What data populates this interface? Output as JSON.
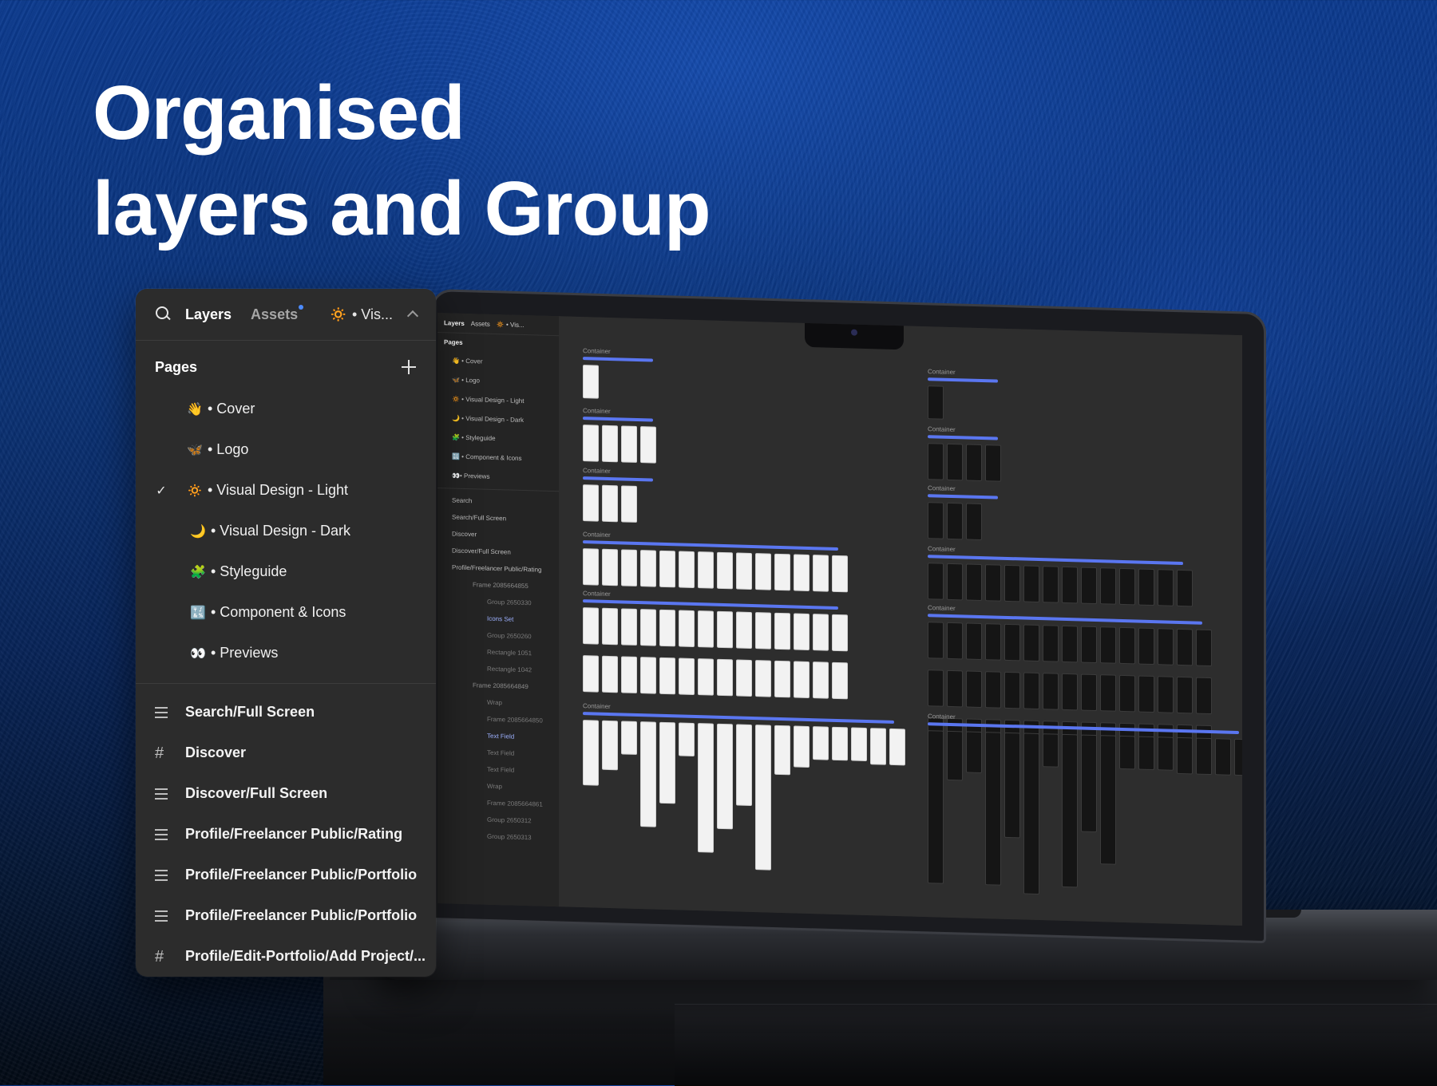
{
  "headline": {
    "line1": "Organised",
    "line2": "layers and Group"
  },
  "panel": {
    "tab_layers": "Layers",
    "tab_assets": "Assets",
    "current_page_emoji": "🔅",
    "current_page_label": "• Vis...",
    "pages_header": "Pages",
    "pages": [
      {
        "emoji": "👋",
        "label": "• Cover",
        "selected": false
      },
      {
        "emoji": "🦋",
        "label": "• Logo",
        "selected": false
      },
      {
        "emoji": "🔅",
        "label": "• Visual Design - Light",
        "selected": true
      },
      {
        "emoji": "🌙",
        "label": "• Visual Design - Dark",
        "selected": false
      },
      {
        "emoji": "🧩",
        "label": "• Styleguide",
        "selected": false
      },
      {
        "emoji": "🔣",
        "label": "• Component & Icons",
        "selected": false
      },
      {
        "emoji": "👀",
        "label": "• Previews",
        "selected": false
      }
    ],
    "layers": [
      {
        "icon": "lines",
        "label": "Search/Full Screen"
      },
      {
        "icon": "hash",
        "label": "Discover"
      },
      {
        "icon": "lines",
        "label": "Discover/Full Screen"
      },
      {
        "icon": "lines",
        "label": "Profile/Freelancer Public/Rating"
      },
      {
        "icon": "lines",
        "label": "Profile/Freelancer Public/Portfolio"
      },
      {
        "icon": "lines",
        "label": "Profile/Freelancer Public/Portfolio"
      },
      {
        "icon": "hash",
        "label": "Profile/Edit-Portfolio/Add Project/..."
      }
    ],
    "check_glyph": "✓"
  },
  "mini_sidebar": {
    "tab_layers": "Layers",
    "tab_assets": "Assets",
    "current": "🔅 • Vis...",
    "pages_header": "Pages",
    "pages": [
      "👋 • Cover",
      "🦋 • Logo",
      "🔅 • Visual Design - Light",
      "🌙 • Visual Design - Dark",
      "🧩 • Styleguide",
      "🔣 • Component & Icons",
      "👀• Previews"
    ],
    "layers": [
      {
        "label": "Search",
        "level": 0
      },
      {
        "label": "Search/Full Screen",
        "level": 0
      },
      {
        "label": "Discover",
        "level": 0
      },
      {
        "label": "Discover/Full Screen",
        "level": 0
      },
      {
        "label": "Profile/Freelancer Public/Rating",
        "level": 0
      },
      {
        "label": "Frame 2085664855",
        "level": 1
      },
      {
        "label": "Group 2650330",
        "level": 2
      },
      {
        "label": "Icons Set",
        "level": 2,
        "hl": true
      },
      {
        "label": "Group 2650260",
        "level": 2
      },
      {
        "label": "Rectangle 1051",
        "level": 2
      },
      {
        "label": "Rectangle 1042",
        "level": 2
      },
      {
        "label": "Frame 2085664849",
        "level": 1
      },
      {
        "label": "Wrap",
        "level": 2
      },
      {
        "label": "Frame 2085664850",
        "level": 2
      },
      {
        "label": "Text Field",
        "level": 2,
        "hl": true
      },
      {
        "label": "Text Field",
        "level": 2
      },
      {
        "label": "Text Field",
        "level": 2
      },
      {
        "label": "Wrap",
        "level": 2
      },
      {
        "label": "Frame 2085664861",
        "level": 2
      },
      {
        "label": "Group 2650312",
        "level": 2
      },
      {
        "label": "Group 2650313",
        "level": 2
      }
    ]
  },
  "canvas": {
    "group_label": "Container"
  },
  "colors": {
    "panel_bg": "#2c2c2c",
    "accent": "#5a76f0",
    "assets_dot": "#4c8bff"
  }
}
